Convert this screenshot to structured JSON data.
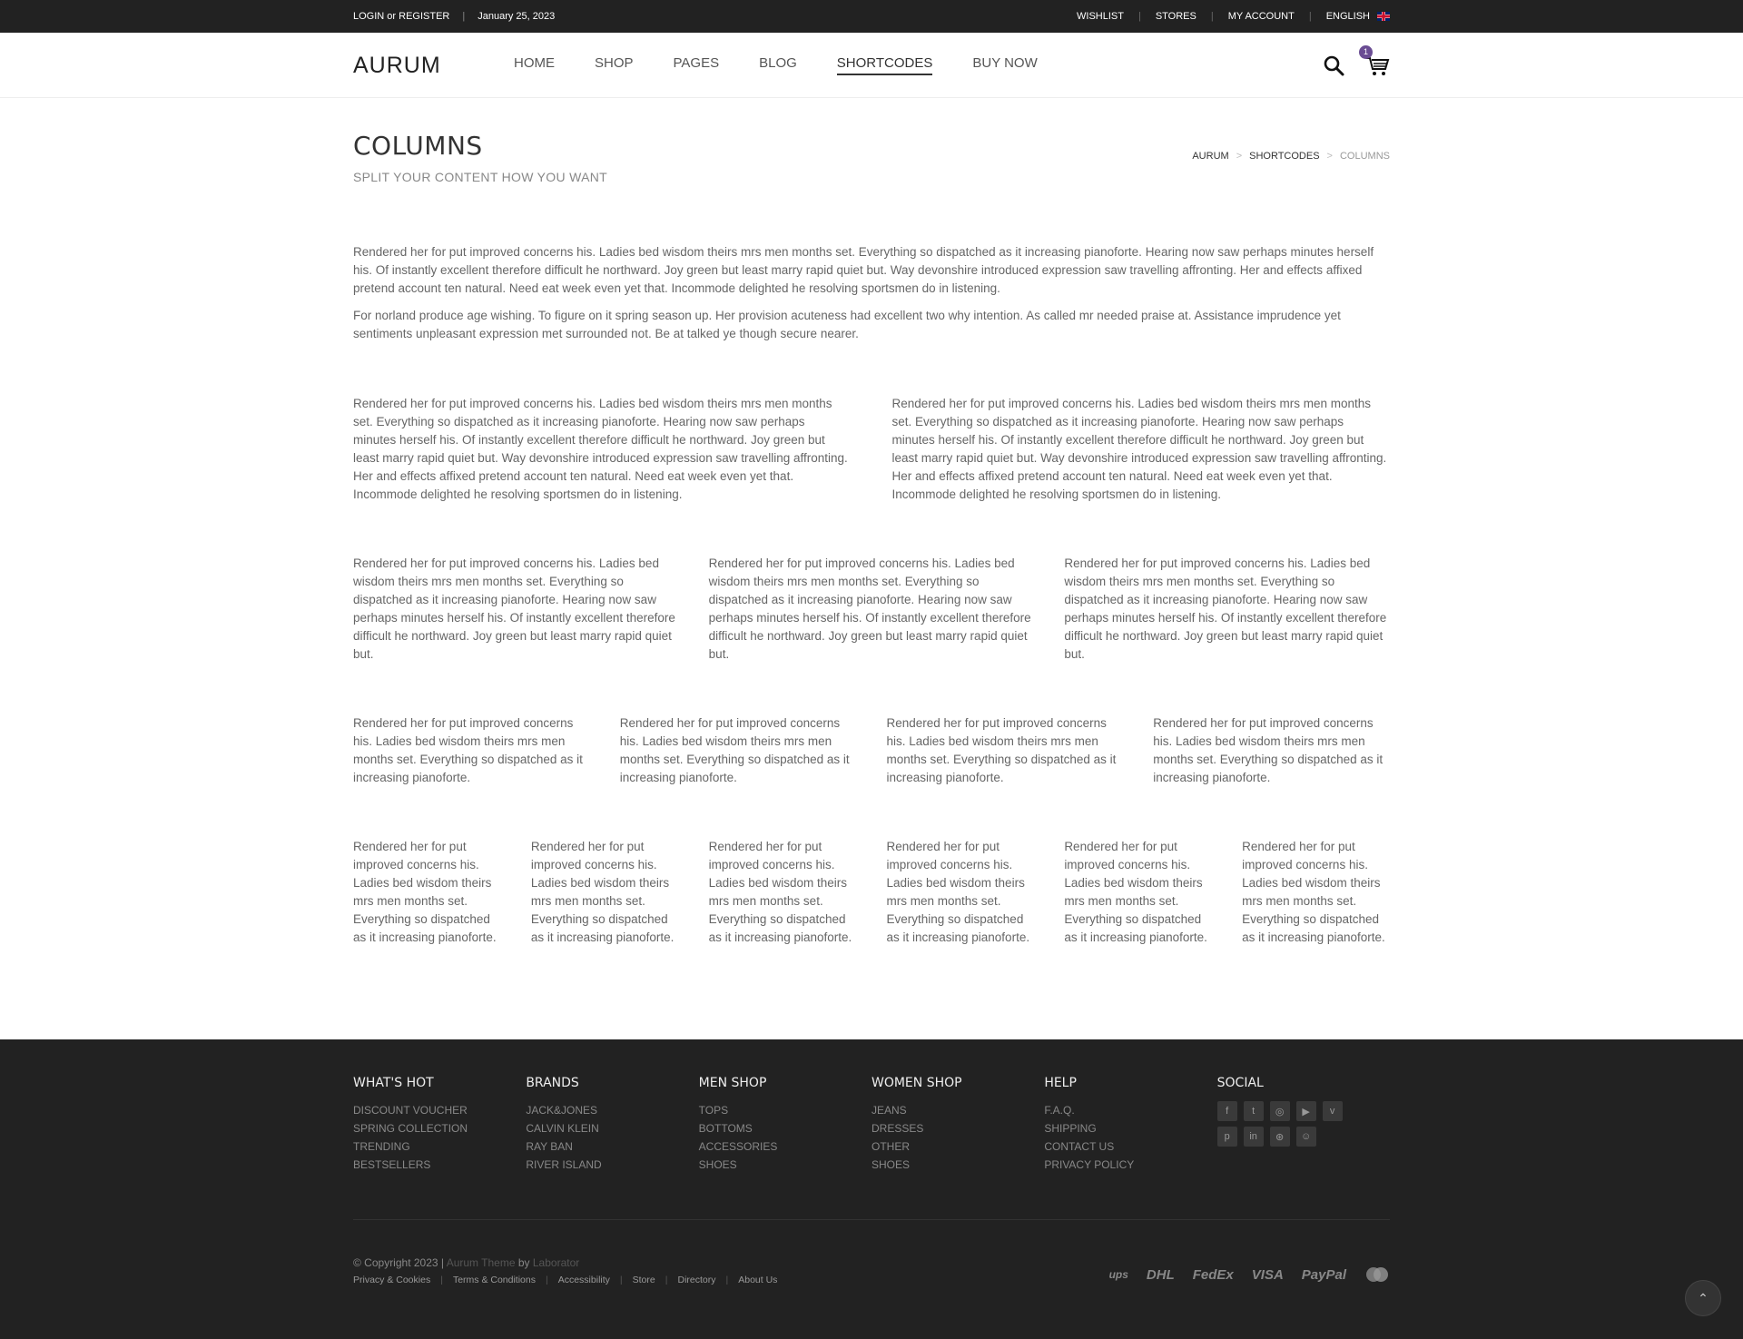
{
  "topbar": {
    "login": "LOGIN or REGISTER",
    "date": "January 25, 2023",
    "links": [
      "WISHLIST",
      "STORES",
      "MY ACCOUNT"
    ],
    "language": "ENGLISH"
  },
  "header": {
    "logo": "AURUM",
    "nav": [
      "HOME",
      "SHOP",
      "PAGES",
      "BLOG",
      "SHORTCODES",
      "BUY NOW"
    ],
    "active_nav": "SHORTCODES",
    "cart_count": "1"
  },
  "page": {
    "title": "COLUMNS",
    "subtitle": "SPLIT YOUR CONTENT HOW YOU WANT",
    "breadcrumb": [
      "AURUM",
      "SHORTCODES",
      "COLUMNS"
    ]
  },
  "content": {
    "full_p1": "Rendered her for put improved concerns his. Ladies bed wisdom theirs mrs men months set. Everything so dispatched as it increasing pianoforte. Hearing now saw perhaps minutes herself his. Of instantly excellent therefore difficult he northward. Joy green but least marry rapid quiet but. Way devonshire introduced expression saw travelling affronting. Her and effects affixed pretend account ten natural. Need eat week even yet that. Incommode delighted he resolving sportsmen do in listening.",
    "full_p2": "For norland produce age wishing. To figure on it spring season up. Her provision acuteness had excellent two why intention. As called mr needed praise at. Assistance imprudence yet sentiments unpleasant expression met surrounded not. Be at talked ye though secure nearer.",
    "half": "Rendered her for put improved concerns his. Ladies bed wisdom theirs mrs men months set. Everything so dispatched as it increasing pianoforte. Hearing now saw perhaps minutes herself his. Of instantly excellent therefore difficult he northward. Joy green but least marry rapid quiet but. Way devonshire introduced expression saw travelling affronting. Her and effects affixed pretend account ten natural. Need eat week even yet that. Incommode delighted he resolving sportsmen do in listening.",
    "third": "Rendered her for put improved concerns his. Ladies bed wisdom theirs mrs men months set. Everything so dispatched as it increasing pianoforte. Hearing now saw perhaps minutes herself his. Of instantly excellent therefore difficult he northward. Joy green but least marry rapid quiet but.",
    "quarter": "Rendered her for put improved concerns his. Ladies bed wisdom theirs mrs men months set. Everything so dispatched as it increasing pianoforte.",
    "sixth": "Rendered her for put improved concerns his. Ladies bed wisdom theirs mrs men months set. Everything so dispatched as it increasing pianoforte."
  },
  "footer": {
    "cols": [
      {
        "title": "WHAT'S HOT",
        "items": [
          "DISCOUNT VOUCHER",
          "SPRING COLLECTION",
          "TRENDING",
          "BESTSELLERS"
        ]
      },
      {
        "title": "BRANDS",
        "items": [
          "JACK&JONES",
          "CALVIN KLEIN",
          "RAY BAN",
          "RIVER ISLAND"
        ]
      },
      {
        "title": "MEN SHOP",
        "items": [
          "TOPS",
          "BOTTOMS",
          "ACCESSORIES",
          "SHOES"
        ]
      },
      {
        "title": "WOMEN SHOP",
        "items": [
          "JEANS",
          "DRESSES",
          "OTHER",
          "SHOES"
        ]
      },
      {
        "title": "HELP",
        "items": [
          "F.A.Q.",
          "SHIPPING",
          "CONTACT US",
          "PRIVACY POLICY"
        ]
      }
    ],
    "social_title": "SOCIAL",
    "social_icons": [
      "facebook-icon",
      "twitter-icon",
      "instagram-icon",
      "youtube-icon",
      "vimeo-icon",
      "pinterest-icon",
      "linkedin-icon",
      "dribbble-icon",
      "snapchat-icon"
    ],
    "copyright": "© Copyright 2023 |",
    "theme": "Aurum Theme",
    "by": "by",
    "author": "Laborator",
    "links": [
      "Privacy & Cookies",
      "Terms & Conditions",
      "Accessibility",
      "Store",
      "Directory",
      "About Us"
    ],
    "payments": [
      "ups",
      "DHL",
      "FedEx",
      "VISA",
      "PayPal"
    ]
  }
}
